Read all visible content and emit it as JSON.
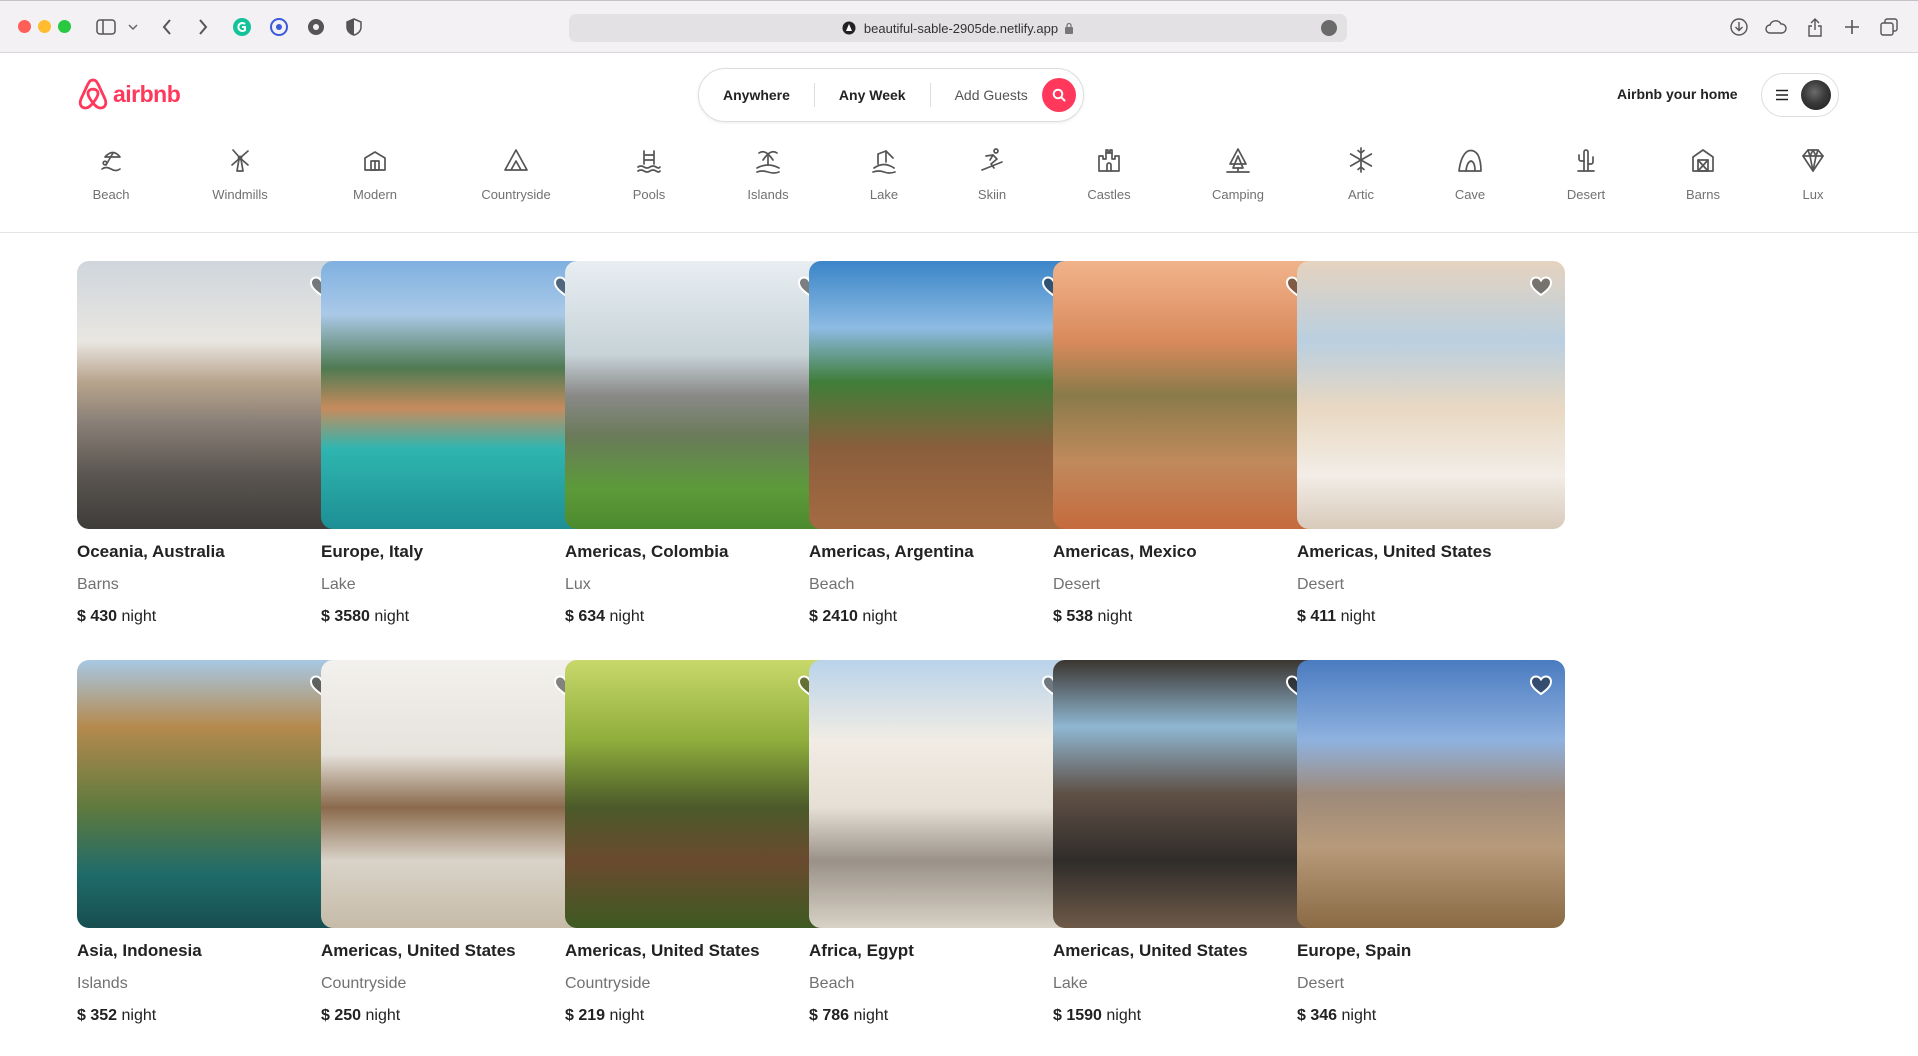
{
  "browser": {
    "url": "beautiful-sable-2905de.netlify.app"
  },
  "header": {
    "brand": "airbnb",
    "search": {
      "location": "Anywhere",
      "dates": "Any Week",
      "guests": "Add Guests"
    },
    "host_link": "Airbnb your home"
  },
  "categories": [
    {
      "label": "Beach",
      "icon": "beach-icon"
    },
    {
      "label": "Windmills",
      "icon": "windmill-icon"
    },
    {
      "label": "Modern",
      "icon": "modern-house-icon"
    },
    {
      "label": "Countryside",
      "icon": "mountain-icon"
    },
    {
      "label": "Pools",
      "icon": "pool-icon"
    },
    {
      "label": "Islands",
      "icon": "island-icon"
    },
    {
      "label": "Lake",
      "icon": "lake-icon"
    },
    {
      "label": "Skiin",
      "icon": "skiing-icon"
    },
    {
      "label": "Castles",
      "icon": "castle-icon"
    },
    {
      "label": "Camping",
      "icon": "camping-icon"
    },
    {
      "label": "Artic",
      "icon": "snowflake-icon"
    },
    {
      "label": "Cave",
      "icon": "cave-icon"
    },
    {
      "label": "Desert",
      "icon": "cactus-icon"
    },
    {
      "label": "Barns",
      "icon": "barn-icon"
    },
    {
      "label": "Lux",
      "icon": "diamond-icon"
    }
  ],
  "listings": [
    {
      "location": "Oceania, Australia",
      "category": "Barns",
      "price": "$ 430",
      "unit": "night"
    },
    {
      "location": "Europe, Italy",
      "category": "Lake",
      "price": "$ 3580",
      "unit": "night"
    },
    {
      "location": "Americas, Colombia",
      "category": "Lux",
      "price": "$ 634",
      "unit": "night"
    },
    {
      "location": "Americas, Argentina",
      "category": "Beach",
      "price": "$ 2410",
      "unit": "night"
    },
    {
      "location": "Americas, Mexico",
      "category": "Desert",
      "price": "$ 538",
      "unit": "night"
    },
    {
      "location": "Americas, United States",
      "category": "Desert",
      "price": "$ 411",
      "unit": "night"
    },
    {
      "location": "Asia, Indonesia",
      "category": "Islands",
      "price": "$ 352",
      "unit": "night"
    },
    {
      "location": "Americas, United States",
      "category": "Countryside",
      "price": "$ 250",
      "unit": "night"
    },
    {
      "location": "Americas, United States",
      "category": "Countryside",
      "price": "$ 219",
      "unit": "night"
    },
    {
      "location": "Africa, Egypt",
      "category": "Beach",
      "price": "$ 786",
      "unit": "night"
    },
    {
      "location": "Americas, United States",
      "category": "Lake",
      "price": "$ 1590",
      "unit": "night"
    },
    {
      "location": "Europe, Spain",
      "category": "Desert",
      "price": "$ 346",
      "unit": "night"
    }
  ],
  "colors": {
    "brand": "#ff385c",
    "text_primary": "#222222",
    "text_secondary": "#717171"
  }
}
